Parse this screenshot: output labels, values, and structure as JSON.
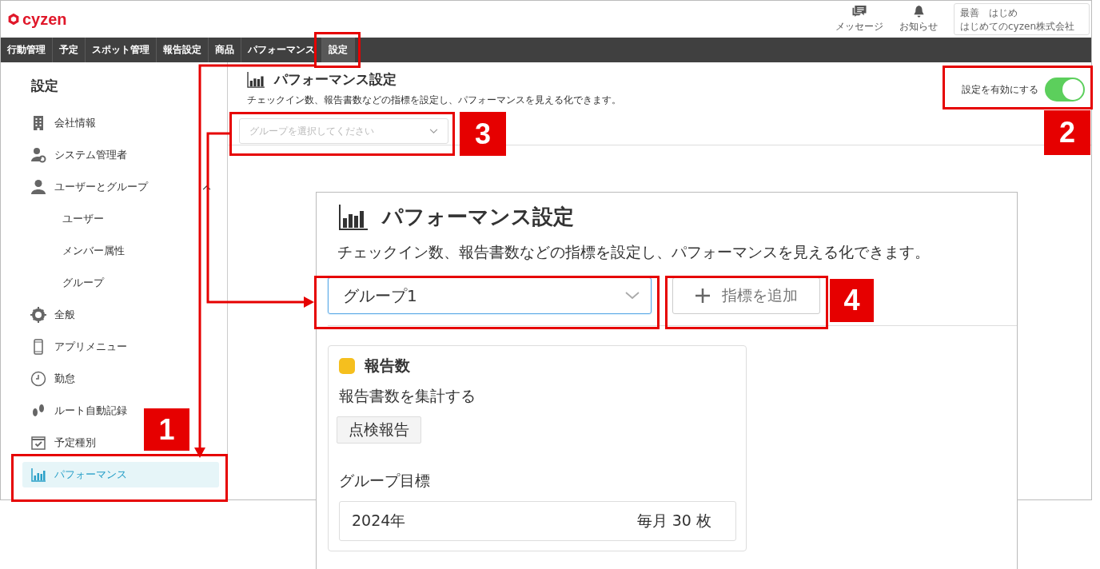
{
  "header": {
    "logo": "cyzen",
    "messages_label": "メッセージ",
    "notifications_label": "お知らせ",
    "user_name": "最善　はじめ",
    "company": "はじめてのcyzen株式会社"
  },
  "nav": [
    {
      "label": "行動管理",
      "selected": false
    },
    {
      "label": "予定",
      "selected": false
    },
    {
      "label": "スポット管理",
      "selected": false
    },
    {
      "label": "報告設定",
      "selected": false
    },
    {
      "label": "商品",
      "selected": false
    },
    {
      "label": "パフォーマンス",
      "selected": false
    },
    {
      "label": "設定",
      "selected": true
    }
  ],
  "sidebar": {
    "title": "設定",
    "items": [
      {
        "label": "会社情報",
        "selected": false
      },
      {
        "label": "システム管理者",
        "selected": false
      },
      {
        "label": "ユーザーとグループ",
        "selected": false,
        "expanded": true,
        "children": [
          {
            "label": "ユーザー",
            "selected": false
          },
          {
            "label": "メンバー属性",
            "selected": false
          },
          {
            "label": "グループ",
            "selected": false
          }
        ]
      },
      {
        "label": "全般",
        "selected": false
      },
      {
        "label": "アプリメニュー",
        "selected": false
      },
      {
        "label": "勤怠",
        "selected": false
      },
      {
        "label": "ルート自動記録",
        "selected": false
      },
      {
        "label": "予定種別",
        "selected": false
      },
      {
        "label": "パフォーマンス",
        "selected": true
      }
    ]
  },
  "page": {
    "title": "パフォーマンス設定",
    "description": "チェックイン数、報告書数などの指標を設定し、パフォーマンスを見える化できます。",
    "group_select": {
      "placeholder": "グループを選択してください"
    },
    "toggle": {
      "label": "設定を有効にする",
      "on": true
    }
  },
  "callout": {
    "title": "パフォーマンス設定",
    "description": "チェックイン数、報告書数などの指標を設定し、パフォーマンスを見える化できます。",
    "group_select": {
      "value": "グループ1"
    },
    "add_button": "指標を追加",
    "metric": {
      "color": "#f5bf1e",
      "name": "報告数",
      "description": "報告書数を集計する",
      "tag": "点検報告",
      "goal_label": "グループ目標",
      "year": "2024年",
      "target": "毎月 30 枚"
    }
  },
  "annotations": [
    "1",
    "2",
    "3",
    "4"
  ]
}
